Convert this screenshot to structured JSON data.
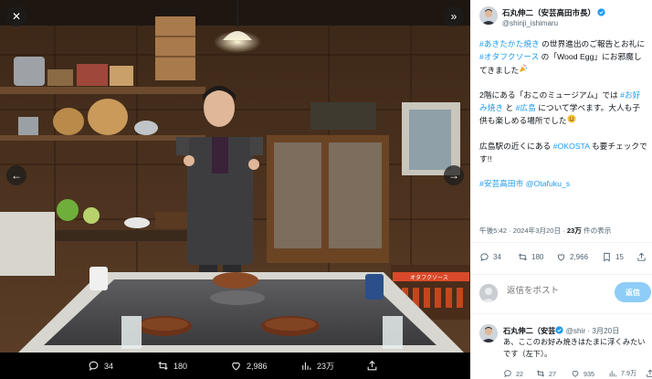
{
  "viewer": {
    "close_icon": "close-icon",
    "expand_icon": "double-chevron-right-icon",
    "prev_icon": "arrow-left-icon",
    "next_icon": "arrow-right-icon",
    "photo_signboard_text": "オタフクソース",
    "actions": {
      "replies": "34",
      "retweets": "180",
      "likes": "2,986",
      "views": "23万"
    }
  },
  "tweet": {
    "author_name": "石丸伸二（安芸高田市長）",
    "author_handle": "@shinji_ishimaru",
    "body": {
      "p1_hashtag1": "#あきたかた焼き",
      "p1_text1": " の世界進出のご報告とお礼に ",
      "p1_hashtag2": "#オタフクソース",
      "p1_text2": " の「Wood Egg」にお邪魔してきました",
      "p2_text1": "2階にある「おこのミュージアム」では ",
      "p2_hashtag1": "#お好み焼き",
      "p2_text2": " と ",
      "p2_hashtag2": "#広島",
      "p2_text3": " について学べます。大人も子供も楽しめる場所でした",
      "p3_text1": "広島駅の近くにある ",
      "p3_hashtag1": "#OKOSTA",
      "p3_text2": " も要チェックです!!",
      "tags_hashtag": "#安芸高田市",
      "tags_mention": "@Otafuku_s"
    },
    "time": "午後5:42 · 2024年3月20日 · ",
    "views_count": "23万",
    "views_label": " 件の表示",
    "stats": {
      "replies": "34",
      "retweets": "180",
      "likes": "2,966",
      "bookmarks": "15"
    }
  },
  "reply_composer": {
    "placeholder": "返信をポスト",
    "button_label": "返信"
  },
  "reply": {
    "author_name": "石丸伸二（安芸",
    "author_meta": " @shir · 3月20日",
    "text": "あ、ここのお好み焼きはたまに浮くみたいです（左下）。",
    "stats": {
      "replies": "22",
      "retweets": "27",
      "likes": "935",
      "views": "7.9万"
    }
  },
  "colors": {
    "accent": "#1d9bf0",
    "reply_button": "#8ecdf7",
    "text_primary": "#0f1419",
    "text_secondary": "#536471"
  }
}
